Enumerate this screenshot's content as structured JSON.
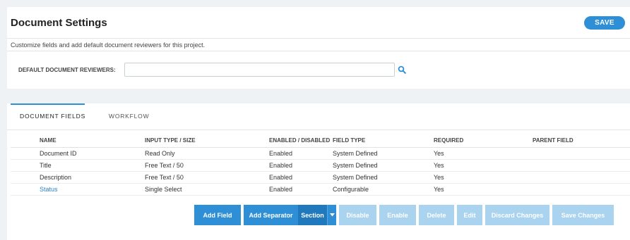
{
  "header": {
    "title": "Document Settings",
    "save_label": "SAVE",
    "description": "Customize fields and add default document reviewers for this project."
  },
  "reviewers": {
    "label": "DEFAULT DOCUMENT REVIEWERS:",
    "value": "",
    "placeholder": ""
  },
  "tabs": [
    {
      "label": "DOCUMENT FIELDS",
      "active": true
    },
    {
      "label": "WORKFLOW",
      "active": false
    }
  ],
  "table": {
    "columns": [
      "NAME",
      "INPUT TYPE / SIZE",
      "ENABLED / DISABLED",
      "FIELD TYPE",
      "REQUIRED",
      "PARENT FIELD"
    ],
    "rows": [
      [
        "Document ID",
        "Read Only",
        "Enabled",
        "System Defined",
        "Yes",
        ""
      ],
      [
        "Title",
        "Free Text / 50",
        "Enabled",
        "System Defined",
        "Yes",
        ""
      ],
      [
        "Description",
        "Free Text / 50",
        "Enabled",
        "System Defined",
        "Yes",
        ""
      ],
      [
        "Status",
        "Single Select",
        "Enabled",
        "Configurable",
        "Yes",
        ""
      ]
    ]
  },
  "actions": {
    "add_field": "Add Field",
    "add_separator": "Add Separator",
    "section": "Section",
    "disable": "Disable",
    "enable": "Enable",
    "delete": "Delete",
    "edit": "Edit",
    "discard": "Discard Changes",
    "save_changes": "Save Changes"
  },
  "colors": {
    "accent": "#2e8fd6",
    "disabled_button": "#a9d3ef",
    "link": "#2e7fc4",
    "background": "#eef2f4"
  }
}
